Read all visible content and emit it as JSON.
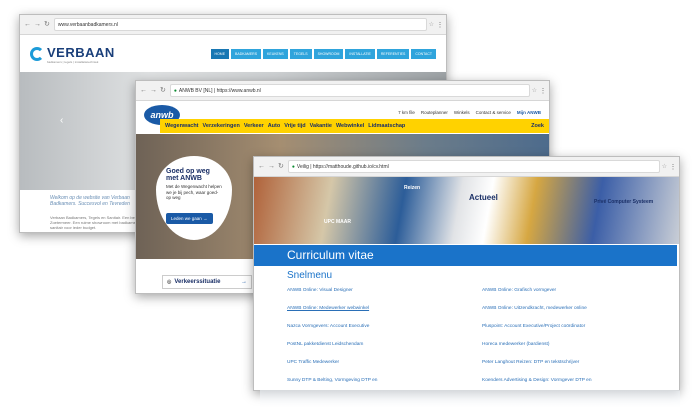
{
  "window1": {
    "url": "www.verbaanbadkamers.nl",
    "logo": "VERBAAN",
    "tagline": "badkamers | tegels | installatietechniek",
    "menu": [
      "HOME",
      "BADKAMERS",
      "KEUKENS",
      "TEGELS",
      "SHOWROOM",
      "INSTALLATIE",
      "REFERENTIES",
      "CONTACT"
    ],
    "welcome": "Welkom op de website van Verbaan Badkamers. Succesvol en Tevreden",
    "body_text": "Verbaan Badkamers, Tegels en Sanitair. Een begrip in Zoetermeer. Een ruime showroom met badkamers en sanitair voor ieder budget."
  },
  "window2": {
    "url": "ANWB BV [NL] | https://www.anwb.nl",
    "logo": "anwb",
    "top_links": [
      "7 km file",
      "Routeplanner",
      "Winkels",
      "Contact & service",
      "Mijn ANWB"
    ],
    "nav": [
      "Wegenwacht",
      "Verzekeringen",
      "Verkeer",
      "Auto",
      "Vrije tijd",
      "Vakantie",
      "Webwinkel",
      "Lidmaatschap"
    ],
    "search": "Zoek",
    "hero_title": "Goed op weg met ANWB",
    "hero_text": "Met de Wegenwacht helpen we je bij pech, waar goed-op weg",
    "hero_button": "Leden we gaan →",
    "traffic": "Verkeerssituatie"
  },
  "window3": {
    "url": "Veilig | https://matthoude.github.io/cv.html",
    "banner_mags": [
      "UPC MAAR",
      "Reizen",
      "Actueel",
      "Privé Computer Systeem"
    ],
    "title": "Curriculum vitae",
    "subtitle": "Snelmenu",
    "links": [
      "ANWB Online: Visual Designer",
      "ANWB Online: Grafisch vormgever",
      "ANWB Online: Medewerker webwinkel",
      "ANWB Online: Uitzendkracht, medewerker online",
      "Nazca Vormgevers: Account Executive",
      "Pluspoint: Account Executive/Project coördinator",
      "PostNL pakketdienst Leidschendam",
      "Horeca medewerker (bardienst)",
      "UPC Traffic Medewerker",
      "Peter Langhout Reizen: DTP en tekstschrijver",
      "Sunny DTP & Belting, Vormgeving DTP en",
      "Koenders Advertising & Design: Vormgever DTP en"
    ]
  }
}
